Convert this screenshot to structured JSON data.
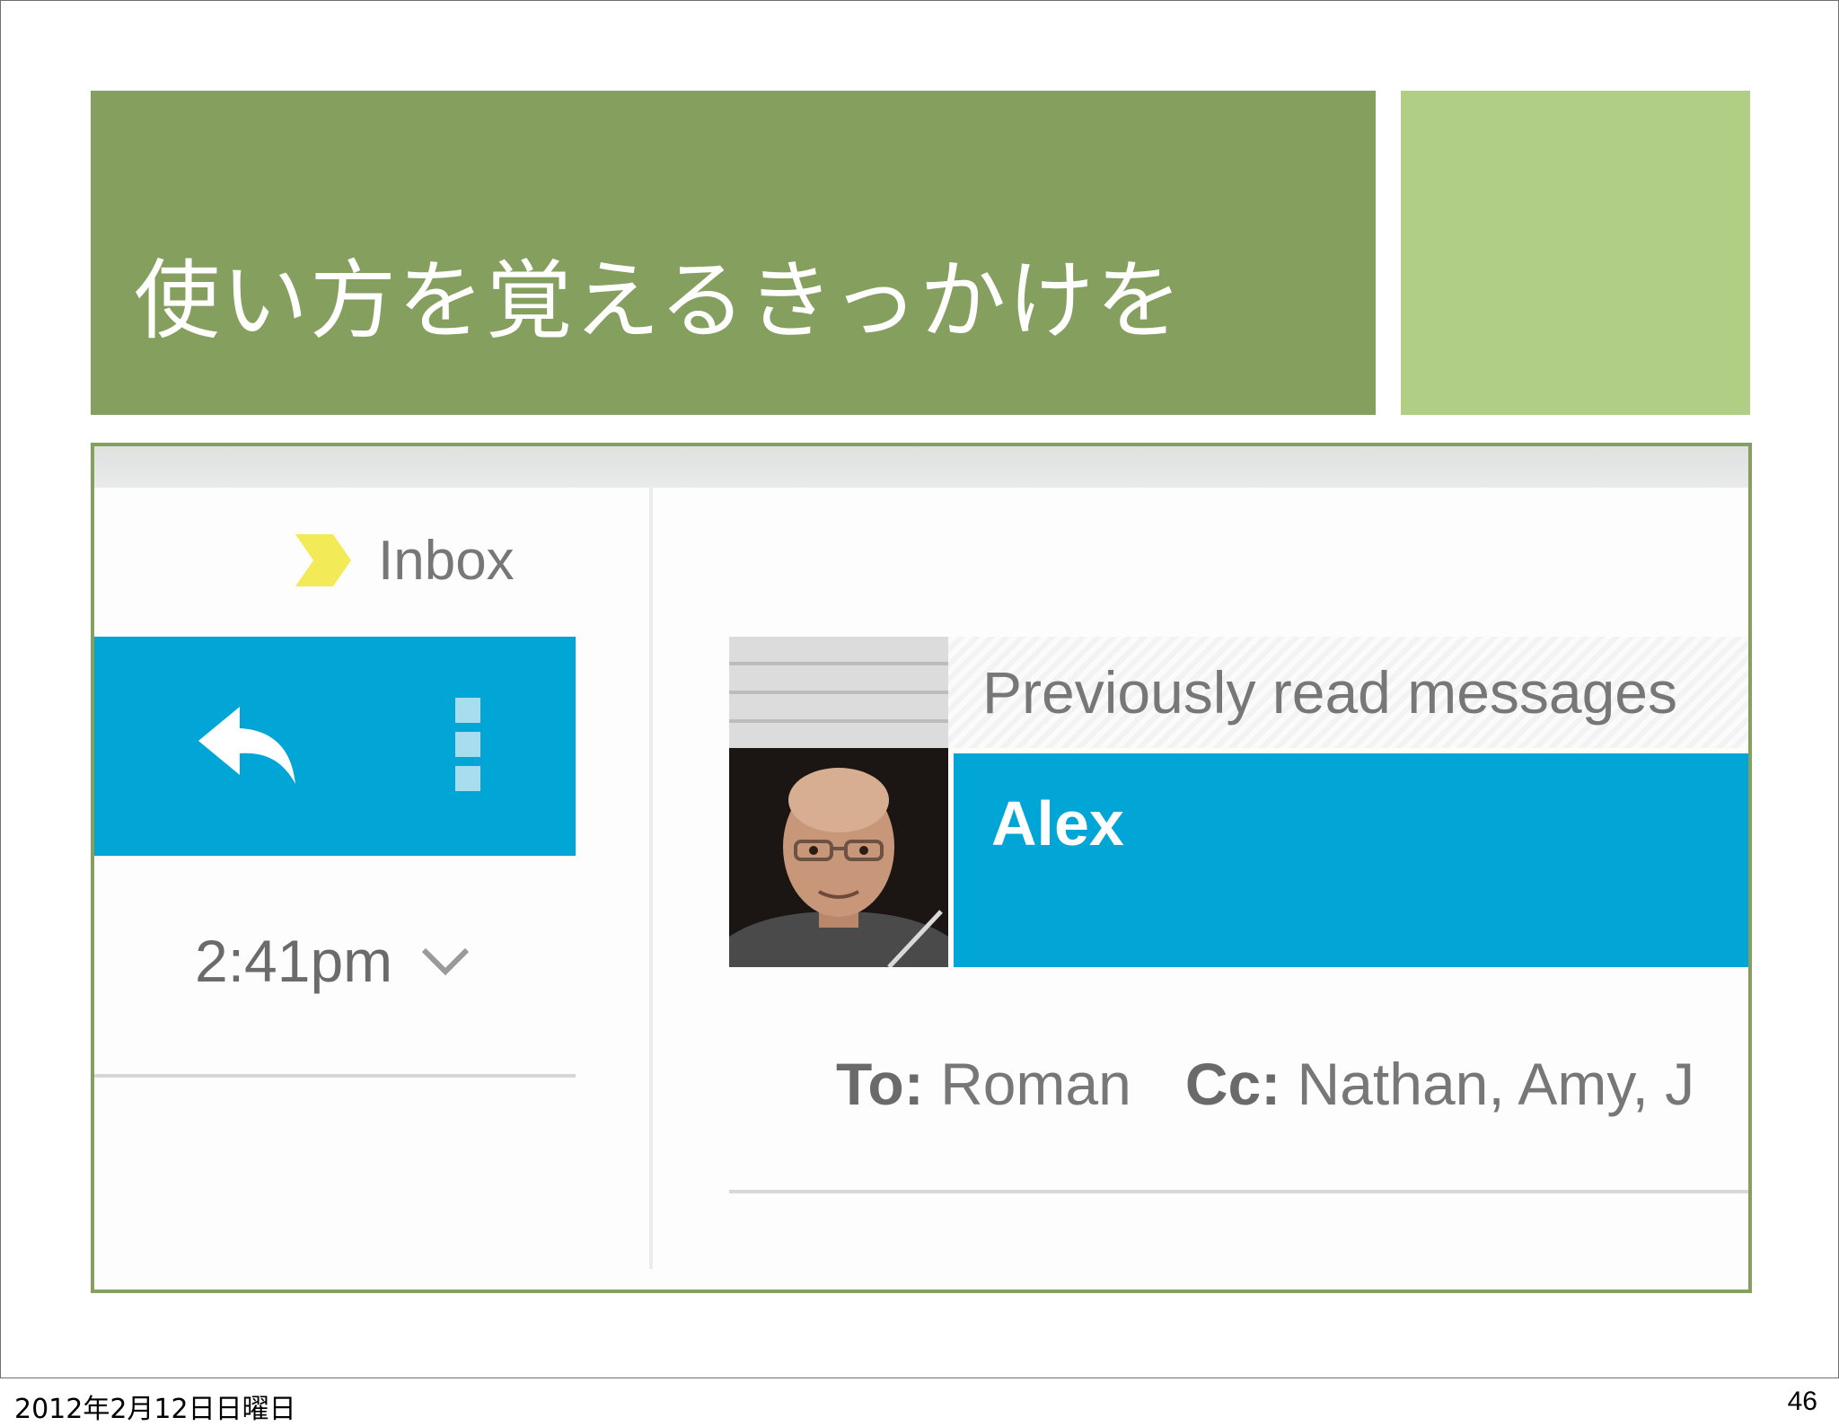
{
  "slide": {
    "title": "使い方を覚えるきっかけを",
    "footer_date": "2012年2月12日日曜日",
    "page_number": "46",
    "colors": {
      "title_bg": "#859f5e",
      "accent_bg": "#b0cf85",
      "ui_accent": "#02a6d6"
    }
  },
  "mail_ui": {
    "folder_label": "Inbox",
    "time": "2:41pm",
    "previously_read": "Previously read messages",
    "sender": "Alex",
    "recipients": {
      "to_label": "To:",
      "to_value": "Roman",
      "cc_label": "Cc:",
      "cc_value": "Nathan, Amy, J"
    },
    "icons": [
      "label-tag-icon",
      "reply-icon",
      "overflow-menu-icon",
      "chevron-down-icon"
    ]
  }
}
